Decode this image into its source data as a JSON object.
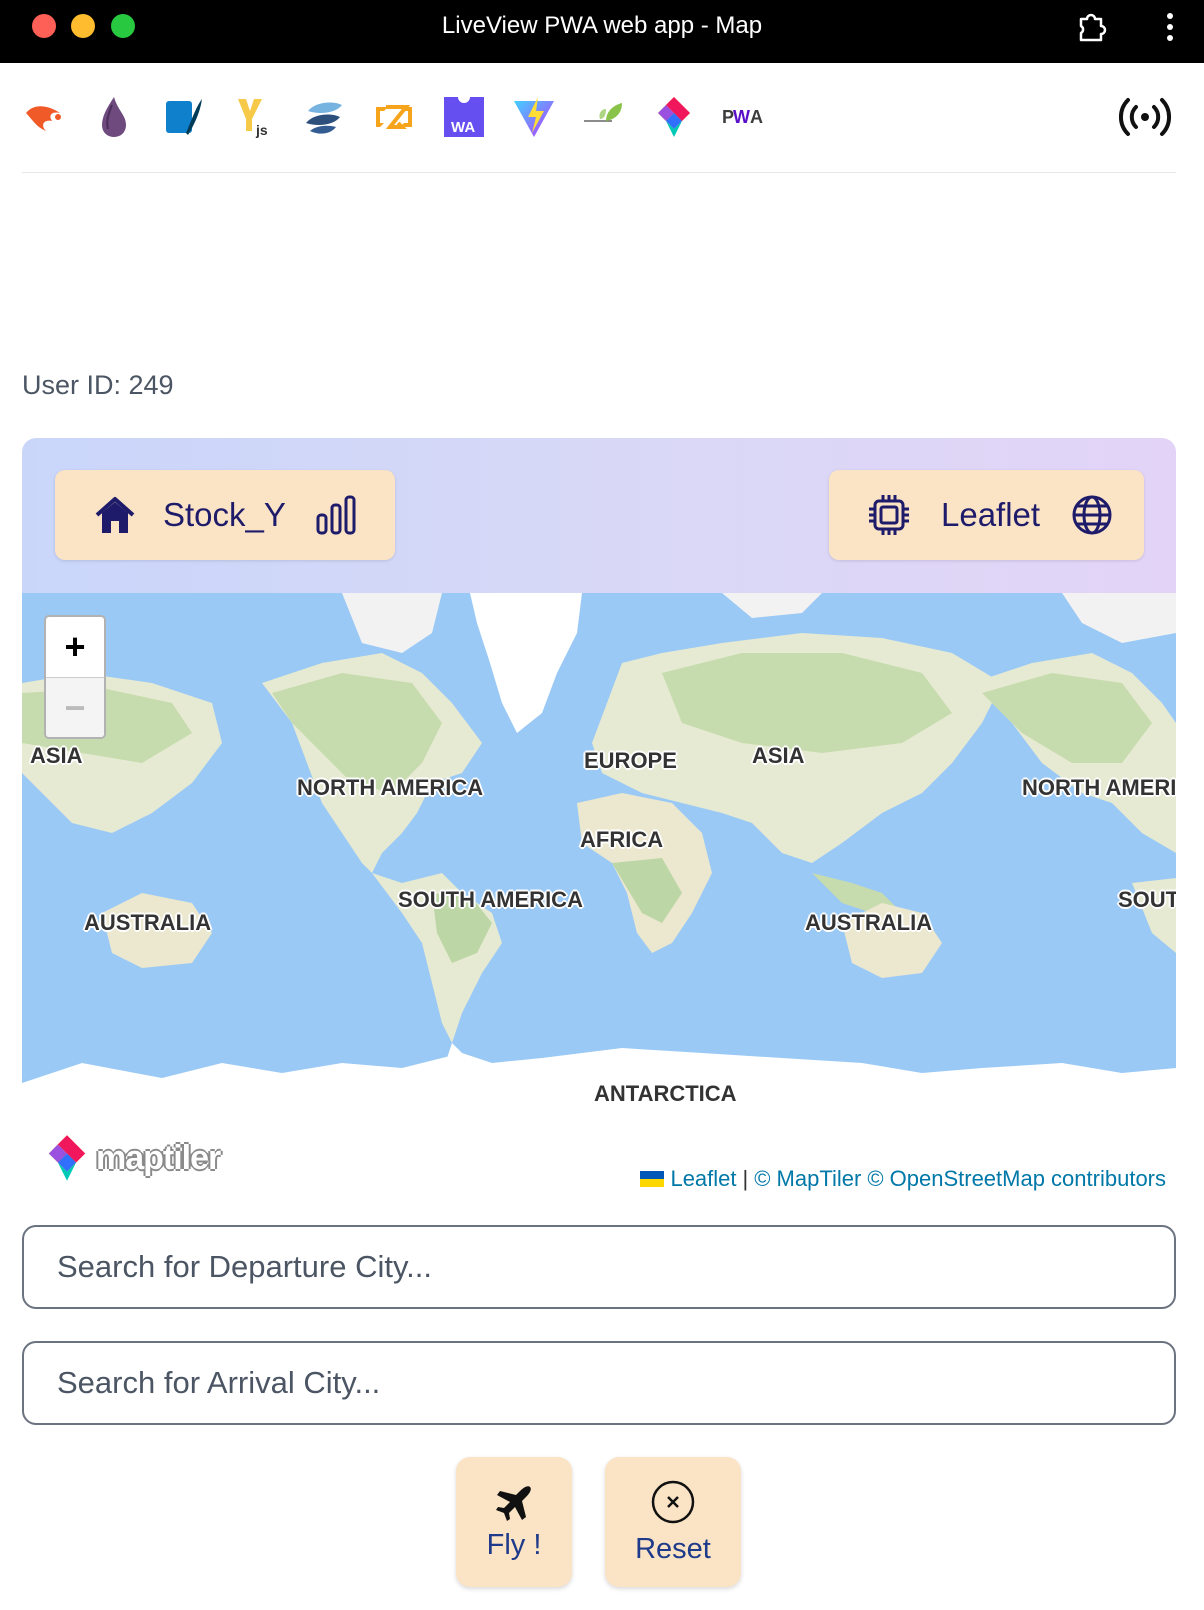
{
  "window": {
    "title": "LiveView PWA web app - Map",
    "buttons": [
      "close",
      "minimize",
      "maximize"
    ],
    "controls": [
      "extensions-icon",
      "more-vert-icon"
    ]
  },
  "logos": [
    "phoenix-logo",
    "elixir-logo",
    "sqlite-logo",
    "yjs-logo",
    "solidjs-logo",
    "zig-logo",
    "webassembly-logo",
    "vite-logo",
    "leaflet-logo",
    "maptiler-logo",
    "pwa-logo"
  ],
  "status_icon": "broadcast-online-icon",
  "user": {
    "label": "User ID: 249"
  },
  "nav": {
    "left": {
      "label": "Stock_Y",
      "icons": [
        "home-icon",
        "bar-chart-icon"
      ]
    },
    "right": {
      "label": "Leaflet",
      "icons": [
        "cpu-chip-icon",
        "globe-icon"
      ]
    },
    "colors": {
      "band_start": "#c9d6fa",
      "band_end": "#e3d4f7",
      "button_bg": "#fbe3c5",
      "text": "#1e1b6b"
    }
  },
  "map": {
    "zoom_in": "+",
    "zoom_out": "−",
    "labels": {
      "asia_west": "ASIA",
      "north_america": "NORTH AMERICA",
      "europe": "EUROPE",
      "asia": "ASIA",
      "north_america_east": "NORTH AMERI",
      "africa": "AFRICA",
      "australia_west": "AUSTRALIA",
      "south_america": "SOUTH AMERICA",
      "australia": "AUSTRALIA",
      "south_east": "SOUT",
      "antarctica": "ANTARCTICA"
    },
    "logo_text": "maptiler",
    "attribution": {
      "leaflet": "Leaflet",
      "separator": "|",
      "maptiler": "© MapTiler",
      "osm": "© OpenStreetMap contributors"
    },
    "colors": {
      "ocean": "#9ac9f5",
      "land": "#e9ecd8",
      "forest": "#bdd6a6",
      "ice": "#ffffff"
    }
  },
  "search": {
    "departure_placeholder": "Search for Departure City...",
    "arrival_placeholder": "Search for Arrival City..."
  },
  "actions": {
    "fly": {
      "label": "Fly !",
      "icon": "airplane-icon"
    },
    "reset": {
      "label": "Reset",
      "icon": "close-circle-icon"
    }
  }
}
